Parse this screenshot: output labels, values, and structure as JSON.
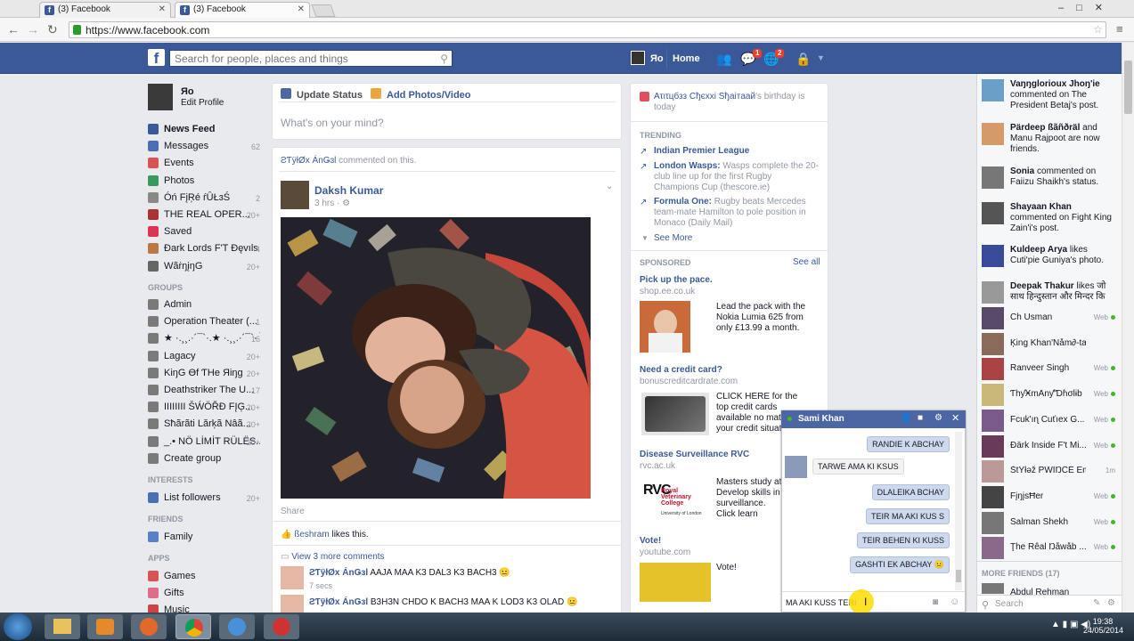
{
  "browser": {
    "tabs": [
      {
        "title": "(3) Facebook"
      },
      {
        "title": "(3) Facebook"
      }
    ],
    "url": "https://www.facebook.com"
  },
  "header": {
    "search_placeholder": "Search for people, places and things",
    "user_name": "Яо",
    "home_label": "Home",
    "messages_badge": "1",
    "notifications_badge": "2"
  },
  "sidebar": {
    "profile_name": "Яо",
    "edit_profile": "Edit Profile",
    "favorites": [
      {
        "label": "News Feed",
        "count": ""
      },
      {
        "label": "Messages",
        "count": "62"
      },
      {
        "label": "Events",
        "count": ""
      },
      {
        "label": "Photos",
        "count": ""
      },
      {
        "label": "Óń FįŖé ŕÛŁɜŚ",
        "count": "2"
      },
      {
        "label": "THE REAL OPER...",
        "count": "20+"
      },
      {
        "label": "Saved",
        "count": ""
      },
      {
        "label": "Ðark Lords F'T Ðęvıls",
        "count": "4"
      },
      {
        "label": "WãṙŋįŋG",
        "count": "20+"
      }
    ],
    "groups_heading": "GROUPS",
    "groups": [
      {
        "label": "Admin",
        "count": ""
      },
      {
        "label": "Operation Theater (...",
        "count": "1"
      },
      {
        "label": "★ ·.¸¸.·´¯`·.★ ·.¸¸.·´¯`· Ĭ",
        "count": "16"
      },
      {
        "label": "Lagacy",
        "count": "20+"
      },
      {
        "label": "KiŋG Ɵf ƬΗe Яiŋg",
        "count": "20+"
      },
      {
        "label": "Deathstriker The U...",
        "count": "17"
      },
      {
        "label": "IIIIIIII ŠẂÖŘĐ FĮĢ...",
        "count": "20+"
      },
      {
        "label": "Sħãrãti Lărķã Nâã...",
        "count": "20+"
      },
      {
        "label": "_.• NÖ LİMİT RÜLËS...",
        "count": "20+"
      },
      {
        "label": "Create group",
        "count": ""
      }
    ],
    "interests_heading": "INTERESTS",
    "interests": [
      {
        "label": "List followers",
        "count": "20+"
      }
    ],
    "friends_heading": "FRIENDS",
    "friends": [
      {
        "label": "Family",
        "count": ""
      }
    ],
    "apps_heading": "APPS",
    "apps": [
      {
        "label": "Games",
        "count": ""
      },
      {
        "label": "Gifts",
        "count": ""
      },
      {
        "label": "Music",
        "count": ""
      }
    ]
  },
  "composer": {
    "update_status": "Update Status",
    "add_photos": "Add Photos/Video",
    "placeholder": "What's on your mind?"
  },
  "post": {
    "story_actor": "ƧƬÿłØx ÁnǤɜl",
    "story_text": "commented on this.",
    "author": "Daksh Kumar",
    "time": "3 hrs · ",
    "share": "Share",
    "likes_name": "ßeshram",
    "likes_text": "likes this.",
    "more_comments": "View 3 more comments",
    "comments": [
      {
        "name": "ƧƬÿłØx ÁnǤɜl",
        "text": "AAJA MAA K3 DAL3 K3 BACH3 ",
        "time": "7 secs"
      },
      {
        "name": "ƧƬÿłØx ÁnǤɜl",
        "text": "B3H3N CHDO K BACH3 MAA K LOD3 K3 OLAD ",
        "time": ""
      }
    ]
  },
  "rightcol": {
    "birthday_name": "Ατιτцбзз Cђєxxі Sђaітaaй",
    "birthday_text": "'s birthday is today",
    "trending_heading": "TRENDING",
    "trending": [
      {
        "title": "Indian Premier League",
        "text": ""
      },
      {
        "title": "London Wasps:",
        "text": "Wasps complete the 20-club line up for the first Rugby Champions Cup (thescore.ie)"
      },
      {
        "title": "Formula One:",
        "text": "Rugby beats Mercedes team-mate Hamilton to pole position in Monaco (Daily Mail)"
      }
    ],
    "see_more": "See More",
    "sponsored_heading": "SPONSORED",
    "see_all": "See all",
    "ads": [
      {
        "title": "Pick up the pace.",
        "domain": "shop.ee.co.uk",
        "body": "Lead the pack with the Nokia Lumia 625 from only £13.99 a month."
      },
      {
        "title": "Need a credit card?",
        "domain": "bonuscreditcardrate.com",
        "body": "CLICK HERE for the top credit cards available no matter your credit situation!"
      },
      {
        "title": "Disease Surveillance RVC",
        "domain": "rvc.ac.uk",
        "body": "Masters study at Develop skills in surveillance. Click learn more."
      },
      {
        "title": "Vote!",
        "domain": "youtube.com",
        "body": "Vote!"
      }
    ],
    "rvc_logo_text": "Royal Veterinary College",
    "rvc_logo_sub": "University of London"
  },
  "ticker": {
    "stories": [
      {
        "name": "Vaŋŋgloriouх Jhoŋ'ie",
        "text": "commented on The President Betaj's post."
      },
      {
        "name": "Pärdeep ßãñðräl",
        "text": "and Manu Rajpoot are now friends."
      },
      {
        "name": "Sonia",
        "text": "commented on Faiizu Shaikh's status."
      },
      {
        "name": "Shayaan Khan",
        "text": "commented on Fight King Zain'i's post."
      },
      {
        "name": "Kuldeep Arya",
        "text": "likes Cuti'pie Guniya's photo."
      },
      {
        "name": "Deepak Thakur",
        "text": "likes जो साथ हिन्दुस्तान और मिन्दर कि"
      }
    ],
    "friends": [
      {
        "name": "Ch Usman",
        "status": "Web"
      },
      {
        "name": "Ķing Khan'Nåm∂-ta Sun...",
        "status": ""
      },
      {
        "name": "Ranveer Singh",
        "status": "Web"
      },
      {
        "name": "ƬhƴӾmȂnƴ'Ɗɦσlɨb",
        "status": "Web"
      },
      {
        "name": "Fcuk'ıɳ Cuťıex G...",
        "status": "Web"
      },
      {
        "name": "Ðǟrk Inside F't Mi...",
        "status": "Web"
      },
      {
        "name": "ŠtŶłəž PŴĪŊĈĒ Emï",
        "status": "1m"
      },
      {
        "name": "FįŋįsĦer",
        "status": "Web"
      },
      {
        "name": "Salman Shekh",
        "status": "Web"
      },
      {
        "name": "Ţhe Rêal Ŋåwåb ...",
        "status": "Web"
      }
    ],
    "more_friends": "MORE FRIENDS (17)",
    "last_friend": "Abdul Rehman",
    "search_placeholder": "Search"
  },
  "chat": {
    "name": "Sami Khan",
    "messages": [
      {
        "side": "right",
        "text": "RANDIE K ABCHAY"
      },
      {
        "side": "left",
        "text": "TARWE AMA KI KSUS"
      },
      {
        "side": "right",
        "text": "DLALEIKA BCHAY"
      },
      {
        "side": "right",
        "text": "TEIR MA AKI KUS S"
      },
      {
        "side": "right",
        "text": "TEIR BEHEN KI KUSS"
      },
      {
        "side": "right",
        "text": "GASHTI EK ABCHAY "
      }
    ],
    "input_value": "MA AKI KUSS TERI"
  },
  "taskbar": {
    "time": "19:38",
    "date": "24/05/2014"
  },
  "colors": {
    "fb_blue": "#3b5998",
    "chat_header": "#4c66a4",
    "online_green": "#42b72a"
  }
}
